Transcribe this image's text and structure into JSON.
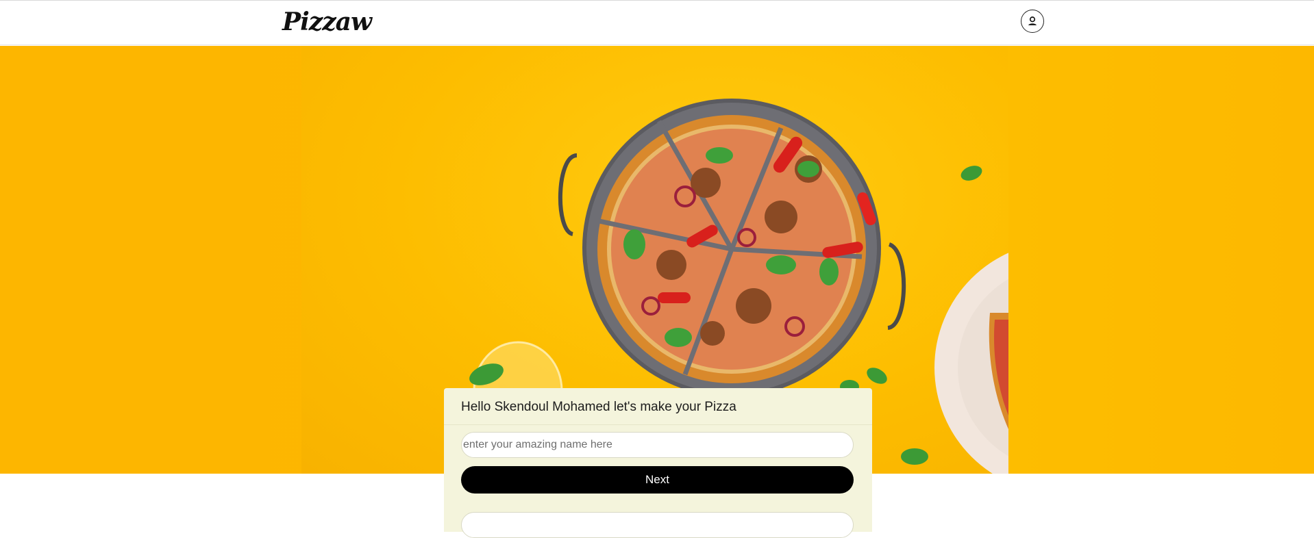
{
  "header": {
    "logo_text": "Pizzaw",
    "profile_icon": "user-circle-icon"
  },
  "hero": {
    "image": "pizza-on-tray-photo",
    "background_color": "#fdb700"
  },
  "form": {
    "greeting": "Hello Skendoul Mohamed let's make your Pizza",
    "name_placeholder": "enter your amazing name here",
    "name_value": "",
    "next_label": "Next",
    "card_color": "#f4f4dc",
    "button_color": "#000000"
  }
}
